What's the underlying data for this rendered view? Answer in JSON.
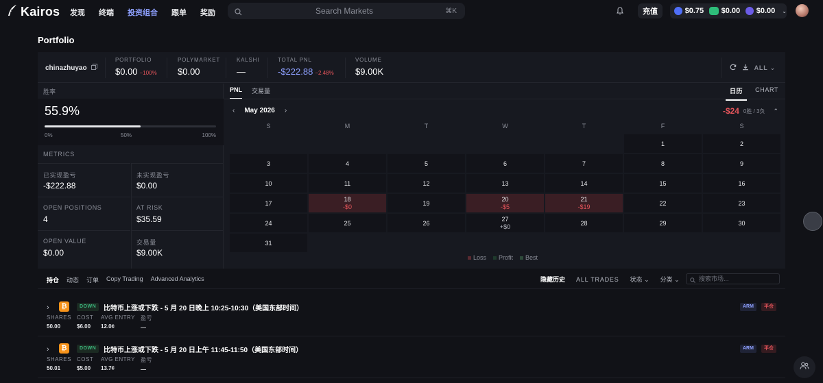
{
  "brand": {
    "name": "Kairos"
  },
  "nav": {
    "items": [
      "发现",
      "终端",
      "投资组合",
      "跟单",
      "奖励"
    ],
    "active": "投资组合"
  },
  "search": {
    "placeholder": "Search Markets",
    "shortcut": "⌘K"
  },
  "header": {
    "deposit": "充值",
    "balances": [
      "$0.75",
      "$0.00",
      "$0.00"
    ]
  },
  "page": {
    "title": "Portfolio"
  },
  "summary": {
    "username": "chinazhuyao",
    "portfolio": {
      "label": "PORTFOLIO",
      "value": "$0.00",
      "change": "−100%"
    },
    "polymarket": {
      "label": "POLYMARKET",
      "value": "$0.00"
    },
    "kalshi": {
      "label": "KALSHI",
      "value": "—"
    },
    "total_pnl": {
      "label": "TOTAL PNL",
      "value": "-$222.88",
      "change": "−2.48%"
    },
    "volume": {
      "label": "VOLUME",
      "value": "$9.00K"
    },
    "filter": "ALL"
  },
  "winrate": {
    "label": "胜率",
    "value": "55.9%",
    "fraction": 0.559,
    "ticks": [
      "0%",
      "50%",
      "100%"
    ]
  },
  "metrics": {
    "label": "METRICS",
    "realized": {
      "label": "已实现盈亏",
      "value": "-$222.88"
    },
    "unrealized": {
      "label": "未实现盈亏",
      "value": "$0.00"
    },
    "open_positions": {
      "label": "OPEN POSITIONS",
      "value": "4"
    },
    "at_risk": {
      "label": "AT RISK",
      "value": "$35.59"
    },
    "open_value": {
      "label": "OPEN VALUE",
      "value": "$0.00"
    },
    "volume": {
      "label": "交易量",
      "value": "$9.00K"
    }
  },
  "chart_tabs": {
    "left": [
      "PNL",
      "交易量"
    ],
    "right": [
      "日历",
      "CHART"
    ]
  },
  "calendar": {
    "month": "May 2026",
    "total": "-$24",
    "record": "0胜 / 3负",
    "weekdays": [
      "S",
      "M",
      "T",
      "W",
      "T",
      "F",
      "S"
    ],
    "legend": [
      "Loss",
      "Profit",
      "Best"
    ],
    "days": [
      {
        "d": "1",
        "col": 5,
        "row": 0
      },
      {
        "d": "2",
        "col": 6,
        "row": 0
      },
      {
        "d": "3",
        "col": 0,
        "row": 1
      },
      {
        "d": "4",
        "col": 1,
        "row": 1
      },
      {
        "d": "5",
        "col": 2,
        "row": 1
      },
      {
        "d": "6",
        "col": 3,
        "row": 1
      },
      {
        "d": "7",
        "col": 4,
        "row": 1
      },
      {
        "d": "8",
        "col": 5,
        "row": 1
      },
      {
        "d": "9",
        "col": 6,
        "row": 1
      },
      {
        "d": "10",
        "col": 0,
        "row": 2
      },
      {
        "d": "11",
        "col": 1,
        "row": 2
      },
      {
        "d": "12",
        "col": 2,
        "row": 2
      },
      {
        "d": "13",
        "col": 3,
        "row": 2
      },
      {
        "d": "14",
        "col": 4,
        "row": 2
      },
      {
        "d": "15",
        "col": 5,
        "row": 2
      },
      {
        "d": "16",
        "col": 6,
        "row": 2
      },
      {
        "d": "17",
        "col": 0,
        "row": 3
      },
      {
        "d": "18",
        "col": 1,
        "row": 3,
        "v": "-$0",
        "kind": "loss"
      },
      {
        "d": "19",
        "col": 2,
        "row": 3
      },
      {
        "d": "20",
        "col": 3,
        "row": 3,
        "v": "-$5",
        "kind": "loss"
      },
      {
        "d": "21",
        "col": 4,
        "row": 3,
        "v": "-$19",
        "kind": "loss"
      },
      {
        "d": "22",
        "col": 5,
        "row": 3
      },
      {
        "d": "23",
        "col": 6,
        "row": 3
      },
      {
        "d": "24",
        "col": 0,
        "row": 4
      },
      {
        "d": "25",
        "col": 1,
        "row": 4
      },
      {
        "d": "26",
        "col": 2,
        "row": 4
      },
      {
        "d": "27",
        "col": 3,
        "row": 4,
        "v": "+$0",
        "kind": "flat"
      },
      {
        "d": "28",
        "col": 4,
        "row": 4
      },
      {
        "d": "29",
        "col": 5,
        "row": 4
      },
      {
        "d": "30",
        "col": 6,
        "row": 4
      },
      {
        "d": "31",
        "col": 0,
        "row": 5
      }
    ]
  },
  "bottom_tabs": {
    "items": [
      "持仓",
      "动态",
      "订单",
      "Copy Trading",
      "Advanced Analytics"
    ],
    "active": "持仓"
  },
  "bottom_controls": {
    "hide_history": "隐藏历史",
    "all_trades": "ALL TRADES",
    "status": "状态",
    "category": "分类",
    "search_placeholder": "搜索市场..."
  },
  "positions": [
    {
      "side": "DOWN",
      "title": "比特币上涨或下跌 - 5 月 20 日晚上 10:25-10:30（美国东部时间）",
      "shares_label": "SHARES",
      "shares": "50.00",
      "cost_label": "COST",
      "cost": "$6.00",
      "avg_label": "AVG ENTRY",
      "avg": "12.0¢",
      "pnl_label": "盈亏",
      "pnl": "—",
      "tag": "ARM",
      "action": "平仓"
    },
    {
      "side": "DOWN",
      "title": "比特币上涨或下跌 - 5 月 20 日上午 11:45-11:50（美国东部时间）",
      "shares_label": "SHARES",
      "shares": "50.01",
      "cost_label": "COST",
      "cost": "$5.00",
      "avg_label": "AVG ENTRY",
      "avg": "13.7¢",
      "pnl_label": "盈亏",
      "pnl": "—",
      "tag": "ARM",
      "action": "平仓"
    }
  ],
  "colors": {
    "accent": "#8ea0ff",
    "loss": "#e3545a",
    "profit": "#3bb77e",
    "background": "#111217"
  }
}
